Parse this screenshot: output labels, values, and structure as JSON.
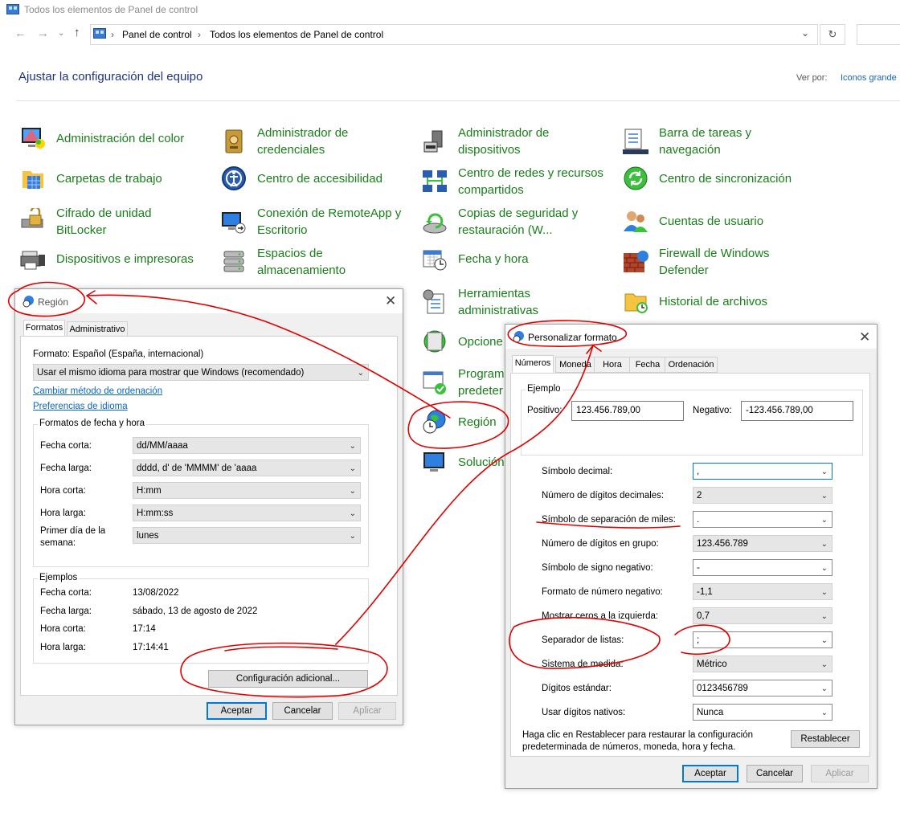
{
  "window": {
    "title": "Todos los elementos de Panel de control"
  },
  "address": {
    "crumb1": "Panel de control",
    "crumb2": "Todos los elementos de Panel de control"
  },
  "header": {
    "title": "Ajustar la configuración del equipo",
    "view_by_label": "Ver por:",
    "view_by_value": "Iconos grande"
  },
  "items": [
    {
      "label": "Administración del color",
      "icon": "color-management-icon"
    },
    {
      "label": "Administrador de credenciales",
      "icon": "credential-manager-icon"
    },
    {
      "label": "Administrador de dispositivos",
      "icon": "device-manager-icon"
    },
    {
      "label": "Barra de tareas y navegación",
      "icon": "taskbar-icon"
    },
    {
      "label": "Carpetas de trabajo",
      "icon": "work-folders-icon"
    },
    {
      "label": "Centro de accesibilidad",
      "icon": "accessibility-icon"
    },
    {
      "label": "Centro de redes y recursos compartidos",
      "icon": "network-icon"
    },
    {
      "label": "Centro de sincronización",
      "icon": "sync-icon"
    },
    {
      "label": "Cifrado de unidad BitLocker",
      "icon": "bitlocker-icon"
    },
    {
      "label": "Conexión de RemoteApp y Escritorio",
      "icon": "remoteapp-icon"
    },
    {
      "label": "Copias de seguridad y restauración (W...",
      "icon": "backup-icon"
    },
    {
      "label": "Cuentas de usuario",
      "icon": "user-accounts-icon"
    },
    {
      "label": "Dispositivos e impresoras",
      "icon": "printer-icon"
    },
    {
      "label": "Espacios de almacenamiento",
      "icon": "storage-icon"
    },
    {
      "label": "Fecha y hora",
      "icon": "calendar-clock-icon"
    },
    {
      "label": "Firewall de Windows Defender",
      "icon": "firewall-icon"
    },
    {
      "label": "Herramientas administrativas",
      "icon": "admin-tools-icon"
    },
    {
      "label": "Historial de archivos",
      "icon": "file-history-icon"
    },
    {
      "label": "Opcione",
      "icon": "internet-options-icon"
    },
    {
      "label": "Program predeter",
      "icon": "default-programs-icon"
    },
    {
      "label": "Región",
      "icon": "globe-clock-icon"
    },
    {
      "label": "Solución",
      "icon": "troubleshoot-icon"
    }
  ],
  "region": {
    "title": "Región",
    "tabs": [
      "Formatos",
      "Administrativo"
    ],
    "format_label": "Formato: Español (España, internacional)",
    "format_value": "Usar el mismo idioma para mostrar que Windows (recomendado)",
    "link_sort": "Cambiar método de ordenación",
    "link_lang": "Preferencias de idioma",
    "group_formats": "Formatos de fecha y hora",
    "rows": [
      {
        "label": "Fecha corta:",
        "value": "dd/MM/aaaa"
      },
      {
        "label": "Fecha larga:",
        "value": "dddd, d' de 'MMMM' de 'aaaa"
      },
      {
        "label": "Hora corta:",
        "value": "H:mm"
      },
      {
        "label": "Hora larga:",
        "value": "H:mm:ss"
      },
      {
        "label": "Primer día de la semana:",
        "value": "lunes"
      }
    ],
    "group_examples": "Ejemplos",
    "examples": [
      {
        "label": "Fecha corta:",
        "value": "13/08/2022"
      },
      {
        "label": "Fecha larga:",
        "value": "sábado, 13 de agosto de 2022"
      },
      {
        "label": "Hora corta:",
        "value": "17:14"
      },
      {
        "label": "Hora larga:",
        "value": "17:14:41"
      }
    ],
    "additional": "Configuración adicional...",
    "ok": "Aceptar",
    "cancel": "Cancelar",
    "apply": "Aplicar"
  },
  "custom": {
    "title": "Personalizar formato",
    "tabs": [
      "Números",
      "Moneda",
      "Hora",
      "Fecha",
      "Ordenación"
    ],
    "example_group": "Ejemplo",
    "positive_label": "Positivo:",
    "positive_value": "123.456.789,00",
    "negative_label": "Negativo:",
    "negative_value": "-123.456.789,00",
    "rows": [
      {
        "label": "Símbolo decimal:",
        "value": ","
      },
      {
        "label": "Número de dígitos decimales:",
        "value": "2"
      },
      {
        "label": "Símbolo de separación de miles:",
        "value": "."
      },
      {
        "label": "Número de dígitos en grupo:",
        "value": "123.456.789"
      },
      {
        "label": "Símbolo de signo negativo:",
        "value": "-"
      },
      {
        "label": "Formato de número negativo:",
        "value": "-1,1"
      },
      {
        "label": "Mostrar ceros a la izquierda:",
        "value": "0,7"
      },
      {
        "label": "Separador de listas:",
        "value": ";"
      },
      {
        "label": "Sistema de medida:",
        "value": "Métrico"
      },
      {
        "label": "Dígitos estándar:",
        "value": "0123456789"
      },
      {
        "label": "Usar dígitos nativos:",
        "value": "Nunca"
      }
    ],
    "note": "Haga clic en Restablecer para restaurar la configuración predeterminada de números, moneda, hora y fecha.",
    "reset": "Restablecer",
    "ok": "Aceptar",
    "cancel": "Cancelar",
    "apply": "Aplicar"
  },
  "colors": {
    "link_green": "#1a7e1a",
    "heading_blue": "#1e3287",
    "annotation_red": "#e00000",
    "focus_blue": "#0078d7"
  }
}
